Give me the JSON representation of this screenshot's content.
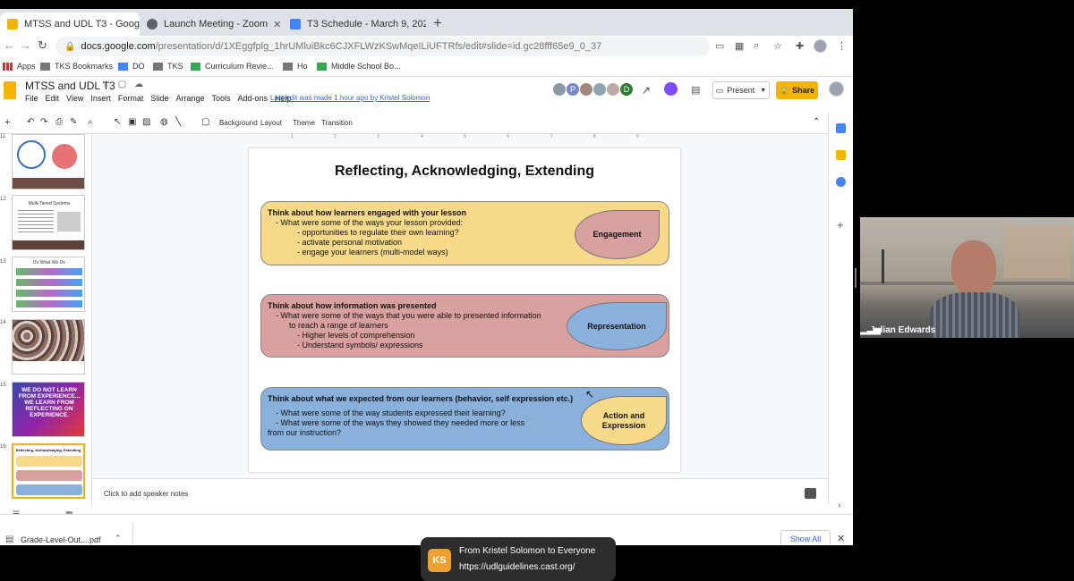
{
  "browser": {
    "tabs": [
      {
        "label": "MTSS and UDL T3 - Google Sli",
        "favicon_color": "#f4b400"
      },
      {
        "label": "Launch Meeting - Zoom",
        "favicon_color": "#5f6368"
      },
      {
        "label": "T3 Schedule - March 9, 2021 -",
        "favicon_color": "#4285f4"
      }
    ],
    "address_domain": "docs.google.com",
    "address_path": "/presentation/d/1XEggfplg_1hrUMluiBkc6CJXFLWzKSwMqeILiUFTRfs/edit#slide=id.gc28fff65e9_0_37",
    "bookmarks": [
      "Apps",
      "TKS Bookmarks",
      "DO",
      "TKS",
      "Curriculum Revie...",
      "Ho",
      "Middle School Bo..."
    ]
  },
  "slides_app": {
    "doc_title": "MTSS and UDL T3",
    "menus": [
      "File",
      "Edit",
      "View",
      "Insert",
      "Format",
      "Slide",
      "Arrange",
      "Tools",
      "Add-ons",
      "Help"
    ],
    "last_edit": "Last edit was made 1 hour ago by Kristel Solomon",
    "present_label": "Present",
    "share_label": "Share",
    "toolbar_labels": {
      "background": "Background",
      "layout": "Layout",
      "theme": "Theme",
      "transition": "Transition"
    },
    "collaborators": [
      {
        "initial": "",
        "color": "#8d99a6"
      },
      {
        "initial": "P",
        "color": "#7986cb"
      },
      {
        "initial": "",
        "color": "#a1887f"
      },
      {
        "initial": "",
        "color": "#90a4ae"
      },
      {
        "initial": "",
        "color": "#bcaaa4"
      },
      {
        "initial": "",
        "color": "#8d6e63"
      },
      {
        "initial": "D",
        "color": "#2e7d32"
      }
    ],
    "speaker_notes_placeholder": "Click to add speaker notes",
    "ruler_ticks": [
      "1",
      "2",
      "3",
      "4",
      "5",
      "6",
      "7",
      "8",
      "9"
    ]
  },
  "filmstrip": [
    {
      "number": "11",
      "title": ""
    },
    {
      "number": "12",
      "title": "Multi-Tiered Systems"
    },
    {
      "number": "13",
      "title": "It's What We Do"
    },
    {
      "number": "14",
      "title": ""
    },
    {
      "number": "15",
      "title": "WE DO NOT LEARN FROM EXPERIENCE... WE LEARN FROM REFLECTING ON EXPERIENCE."
    },
    {
      "number": "16",
      "title": "Reflecting, Acknowledging, Extending",
      "selected": true
    }
  ],
  "slide": {
    "title": "Reflecting, Acknowledging, Extending",
    "sections": [
      {
        "heading": "Think about how learners engaged with your lesson",
        "lines": [
          "- What were some of the ways your lesson provided:",
          "- opportunities to regulate their own learning?",
          "- activate personal motivation",
          "- engage your learners (multi-model ways)"
        ],
        "bubble": "Engagement",
        "color": "#f7d98a",
        "bubble_color": "#d9a0a0"
      },
      {
        "heading": "Think about how information was presented",
        "lines": [
          "- What were some of  the ways that you were able to presented information",
          "to reach a range of learners",
          "- Higher levels of comprehension",
          "- Understand symbols/ expressions"
        ],
        "bubble": "Representation",
        "color": "#d9a0a0",
        "bubble_color": "#8ab0dc"
      },
      {
        "heading": "Think about what we expected from our learners (behavior, self expression etc.)",
        "lines": [
          "- What were some of the way students expressed their learning?",
          "- What were some of the ways they showed they needed more or less",
          "from our instruction?"
        ],
        "bubble": "Action and Expression",
        "color": "#8ab0dc",
        "bubble_color": "#f7d98a"
      }
    ]
  },
  "downloads": {
    "file": "Grade-Level-Out....pdf",
    "show_all": "Show All"
  },
  "zoom": {
    "participant_name": "Julian Edwards"
  },
  "chat": {
    "avatar_initials": "KS",
    "from": "From Kristel Solomon to Everyone",
    "message": "https://udlguidelines.cast.org/"
  }
}
